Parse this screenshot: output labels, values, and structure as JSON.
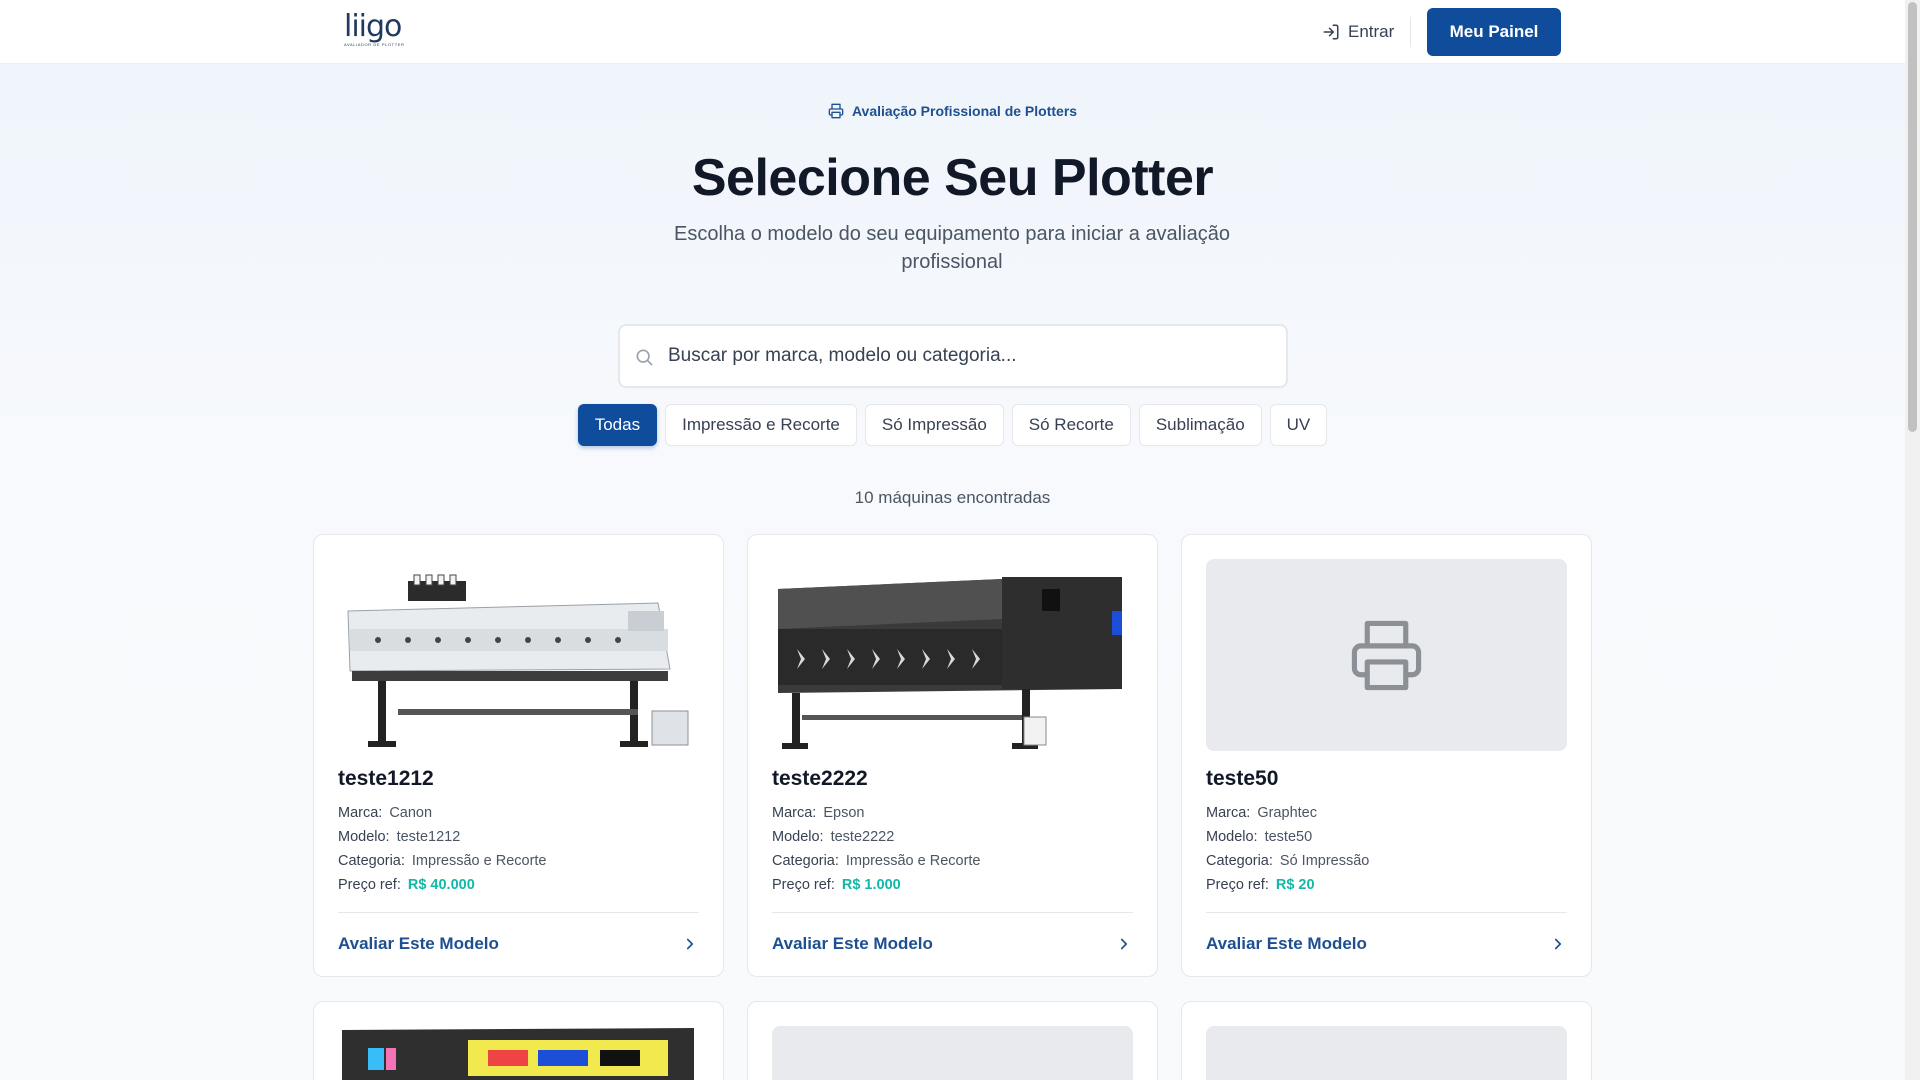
{
  "header": {
    "logo_text": "liigo",
    "logo_tagline": "AVALIADOR DE PLOTTER",
    "login_label": "Entrar",
    "panel_label": "Meu Painel"
  },
  "hero": {
    "eyebrow": "Avaliação Profissional de Plotters",
    "title": "Selecione Seu Plotter",
    "subtitle": "Escolha o modelo do seu equipamento para iniciar a avaliação profissional"
  },
  "search": {
    "placeholder": "Buscar por marca, modelo ou categoria..."
  },
  "filters": [
    {
      "label": "Todas",
      "active": true
    },
    {
      "label": "Impressão e Recorte",
      "active": false
    },
    {
      "label": "Só Impressão",
      "active": false
    },
    {
      "label": "Só Recorte",
      "active": false
    },
    {
      "label": "Sublimação",
      "active": false
    },
    {
      "label": "UV",
      "active": false
    }
  ],
  "results_count": "10 máquinas encontradas",
  "labels": {
    "brand": "Marca:",
    "model": "Modelo:",
    "category": "Categoria:",
    "price": "Preço ref:",
    "cta": "Avaliar Este Modelo"
  },
  "cards": [
    {
      "name": "teste1212",
      "brand": "Canon",
      "model": "teste1212",
      "category": "Impressão e Recorte",
      "price": "R$ 40.000",
      "image": "white-plotter-photo"
    },
    {
      "name": "teste2222",
      "brand": "Epson",
      "model": "teste2222",
      "category": "Impressão e Recorte",
      "price": "R$ 1.000",
      "image": "black-plotter-photo"
    },
    {
      "name": "teste50",
      "brand": "Graphtec",
      "model": "teste50",
      "category": "Só Impressão",
      "price": "R$ 20",
      "image": "printer-placeholder-icon"
    }
  ],
  "colors": {
    "primary": "#0f4c9c",
    "price": "#14b8a6",
    "link": "#1d4f91"
  }
}
